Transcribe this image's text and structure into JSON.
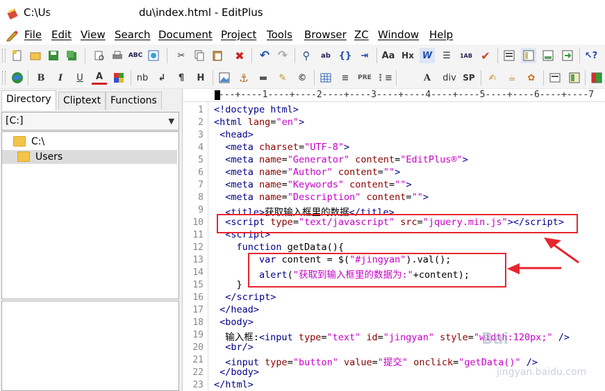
{
  "window": {
    "title_prefix": "C:\\Us",
    "title_suffix": "du\\index.html - EditPlus"
  },
  "menu": [
    "File",
    "Edit",
    "View",
    "Search",
    "Document",
    "Project",
    "Tools",
    "Browser",
    "ZC",
    "Window",
    "Help"
  ],
  "toolbar2_labels": {
    "bold": "B",
    "italic": "I",
    "underline": "U",
    "font_color": "A",
    "nb": "nb",
    "br": "↲",
    "para": "¶",
    "hr": "H",
    "div": "div",
    "sp": "SP",
    "pre": "PRE"
  },
  "left_pane": {
    "tabs": [
      "Directory",
      "Cliptext",
      "Functions"
    ],
    "drive": "[C:]",
    "tree": [
      "C:\\",
      "Users"
    ]
  },
  "editor": {
    "ruler": "---+----1----+----2----+----3----+----4----+----5----+----6----+----7",
    "line_numbers": [
      "1",
      "2",
      "3",
      "4",
      "5",
      "6",
      "7",
      "8",
      "9",
      "10",
      "11",
      "12",
      "13",
      "14",
      "15",
      "16",
      "17",
      "18",
      "19",
      "20",
      "21",
      "22",
      "23"
    ]
  },
  "watermark": {
    "brand": "Bai",
    "site": "jingyan.baidu.com"
  }
}
